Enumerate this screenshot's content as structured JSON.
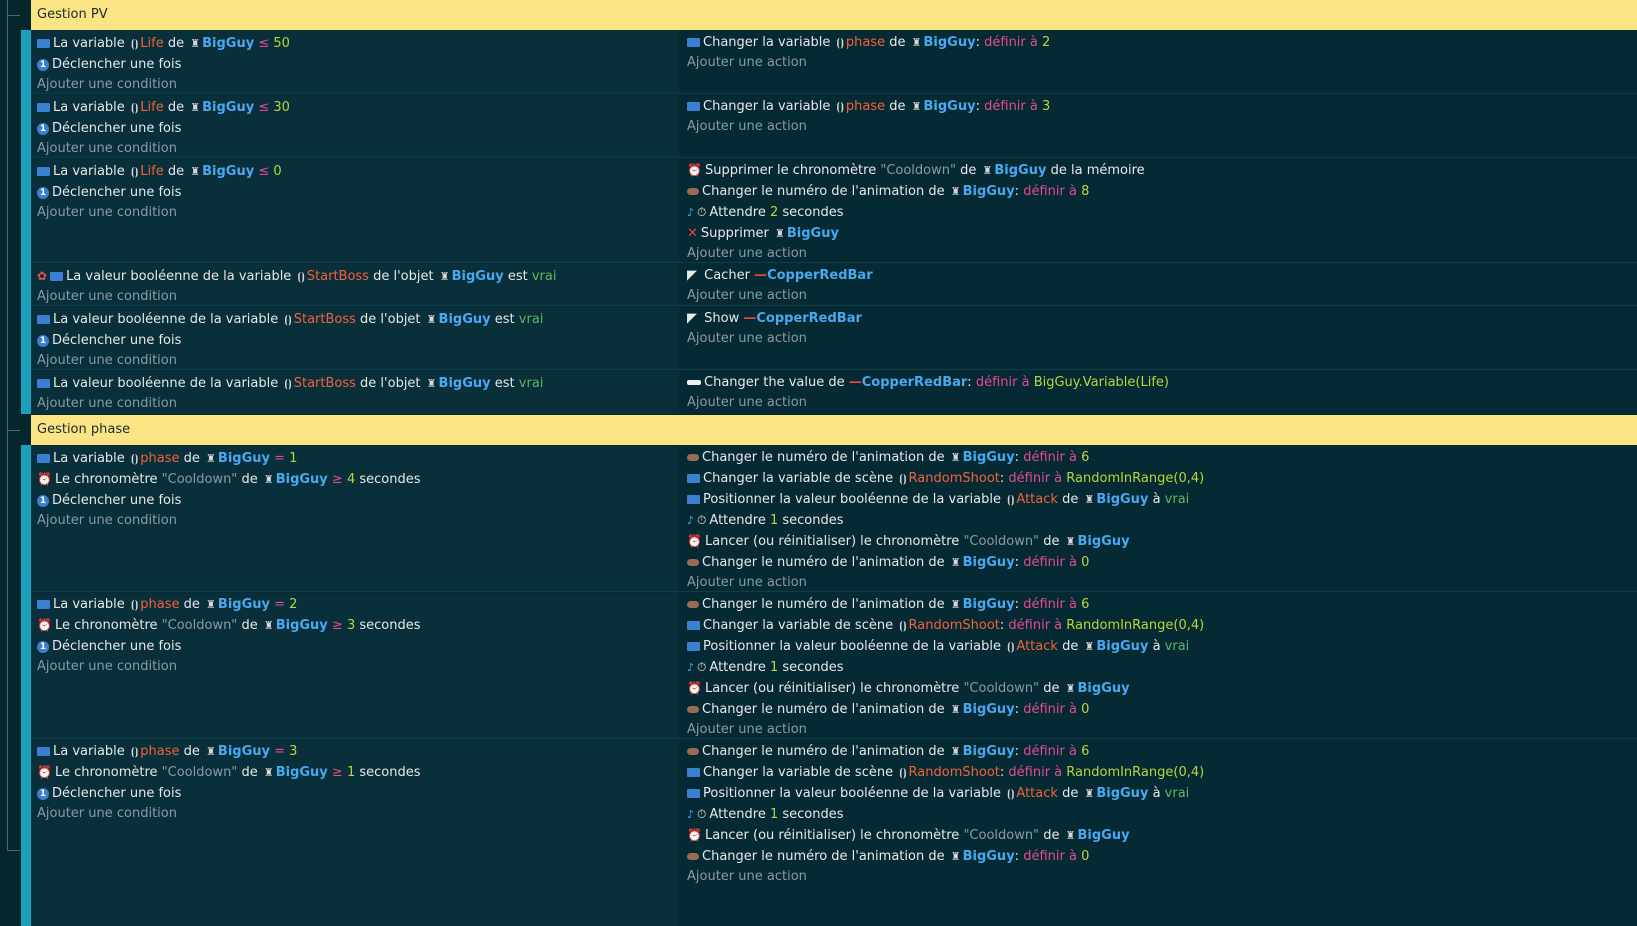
{
  "groups": {
    "pv": "Gestion PV",
    "phase": "Gestion phase"
  },
  "common": {
    "add_condition": "Ajouter une condition",
    "add_action": "Ajouter une action",
    "trigger_once": "Déclencher une fois",
    "la_variable": "La variable",
    "de": "de",
    "bigguy": "BigGuy",
    "life": "Life",
    "phase": "phase",
    "le_chrono": "Le chronomètre",
    "cooldown": "\"Cooldown\"",
    "secondes": "secondes",
    "bool_var": "La valeur booléenne de la variable",
    "startboss": "StartBoss",
    "de_objet": "de l'objet",
    "est": "est",
    "vrai": "vrai",
    "changer_variable": "Changer la variable",
    "definir_a": "définir à",
    "colon": ":",
    "change_anim": "Changer le numéro de l'animation de",
    "change_scene_var": "Changer la variable de scène",
    "randomshoot": "RandomShoot",
    "random_expr": "RandomInRange(0,4)",
    "positionner_bool": "Positionner la valeur booléenne de la variable",
    "attack": "Attack",
    "a": "à",
    "attendre": "Attendre",
    "lancer_chrono": "Lancer (ou réinitialiser) le chronomètre",
    "supprimer_chrono": "Supprimer le chronomètre",
    "de_la_memoire": "de la mémoire",
    "supprimer": "Supprimer",
    "cacher": "Cacher",
    "show": "Show",
    "copperredbar": "CopperRedBar",
    "changer_value": "Changer the value de",
    "bigguy_life_expr": "BigGuy.Variable(Life)",
    "le": "≤",
    "ge": "≥",
    "eq": "="
  },
  "values": {
    "life50": "50",
    "life30": "30",
    "life0": "0",
    "phase2": "2",
    "phase3": "3",
    "anim8": "8",
    "wait2": "2",
    "p1": "1",
    "p2": "2",
    "p3": "3",
    "cd4": "4",
    "cd3": "3",
    "cd1": "1",
    "anim6": "6",
    "anim0": "0",
    "wait1": "1"
  },
  "colors": {
    "header_bg": "#fbe483",
    "object": "#4aa8f0",
    "variable": "#f2623a",
    "operator": "#e44b8e",
    "number": "#b7d63a"
  }
}
